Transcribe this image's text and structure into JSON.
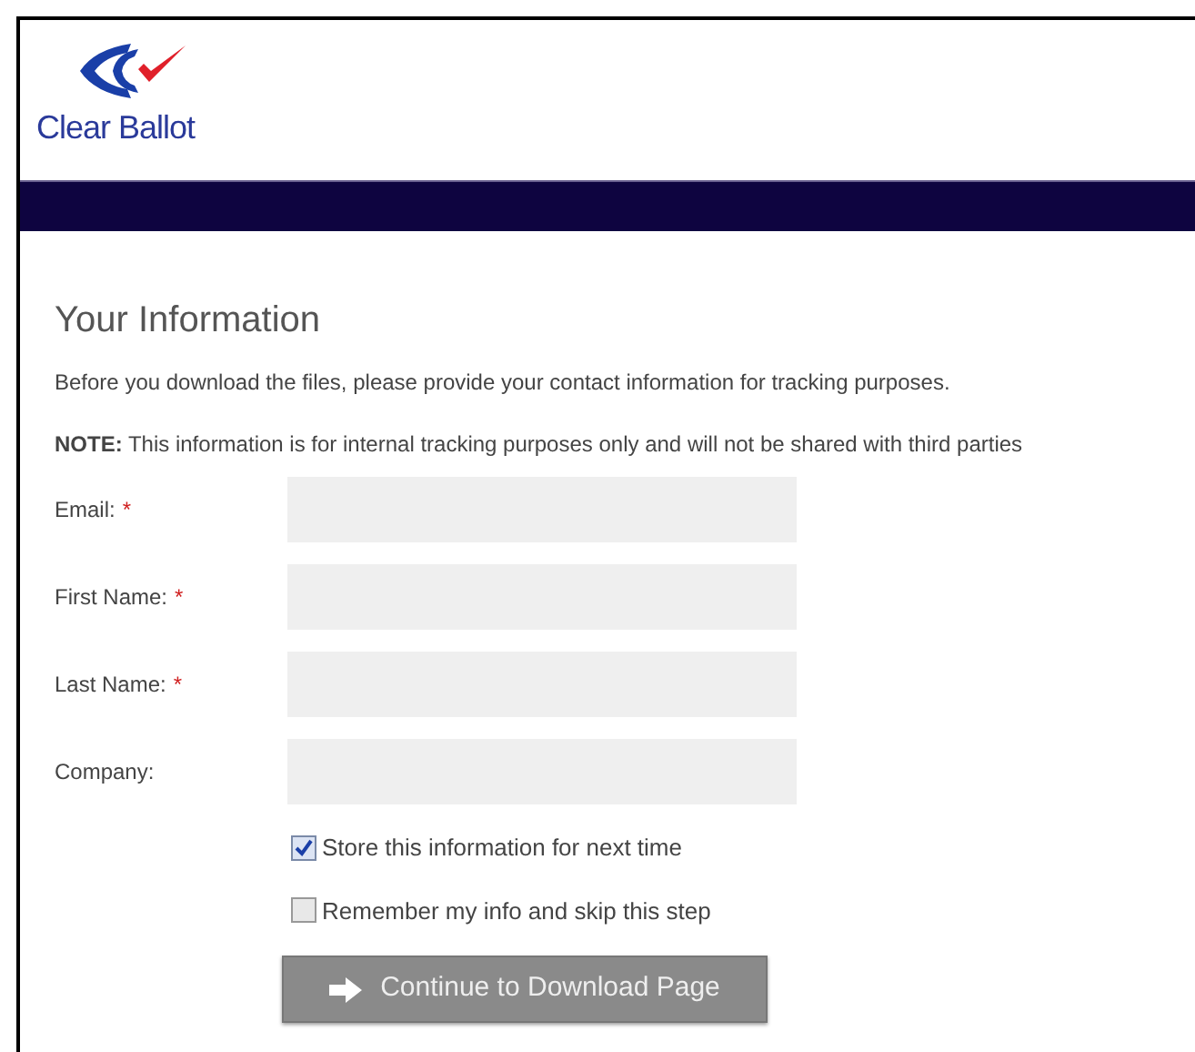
{
  "logo": {
    "name": "Clear Ballot"
  },
  "heading": "Your Information",
  "intro": "Before you download the files, please provide your contact information for tracking purposes.",
  "note": "**NOTE:** This information is for internal tracking purposes only and will not be shared with third parties",
  "fields": [
    {
      "label": "Email:",
      "required_mark": "*"
    },
    {
      "label": "First Name:",
      "required_mark": "*"
    },
    {
      "label": "Last Name:",
      "required_mark": "*"
    },
    {
      "label": "Company:"
    }
  ],
  "options": [
    {
      "label": "Store this information for next time",
      "checked": true
    },
    {
      "label": "Remember my info and skip this step",
      "checked": false
    }
  ],
  "submit_button": {
    "label": "Continue to Download Page"
  }
}
